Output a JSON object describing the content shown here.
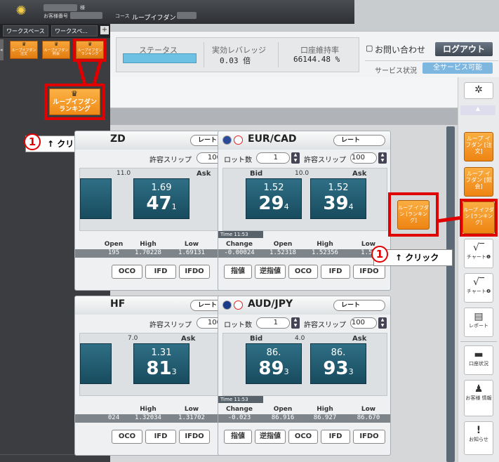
{
  "header": {
    "honorific": "様",
    "customer_number_label": "お客様番号",
    "course_label": "コース",
    "course_value": "ループイフダン"
  },
  "workspace": {
    "tabs": [
      "ワークスペース",
      "ワークスペ..."
    ],
    "plus": "+"
  },
  "left_minis": [
    {
      "label": "ループイフダン 注文"
    },
    {
      "label": "ループイフダン 照会"
    },
    {
      "label": "ループイフダン ランキング"
    }
  ],
  "big_button": {
    "label": "ループイフダン ランキング"
  },
  "callouts": [
    {
      "num": "1",
      "text": "↑ クリック"
    },
    {
      "num": "1",
      "text": "↑ クリック"
    }
  ],
  "status": {
    "status_label": "ステータス",
    "leverage_label": "実効レバレッジ",
    "leverage_value": "0.03 倍",
    "margin_label": "口座維持率",
    "margin_value": "66144.48 %"
  },
  "topright": {
    "inquiry": "お問い合わせ",
    "logout": "ログアウト",
    "service_label": "サービス状況",
    "service_value": "全サービス可能"
  },
  "rightnav": {
    "gear": "✲",
    "order": "ループ イフダン [注文]",
    "inquiry": "ループ イフダン [照会]",
    "ranking": "ループ イフダン [ランキング]",
    "chart1": "チャート❶",
    "chart2": "チャート❷",
    "report": "レポート",
    "account": "口座状況",
    "customer": "お客様 情報",
    "notice": "お知らせ"
  },
  "ranking_float": {
    "label": "ループ イフダン [ランキング]"
  },
  "panels": {
    "p1": {
      "name": "ZD",
      "spread": "11.0",
      "bid_sm": "",
      "bid_big": "",
      "ask_sm": "1.69",
      "ask_big": "47",
      "ask_x": "1",
      "change": "",
      "open": "195",
      "high": "1.70228",
      "low": "1.69131"
    },
    "p2": {
      "name": "EUR/CAD",
      "spread": "10.0",
      "bid_sm": "1.52",
      "bid_big": "29",
      "bid_x": "4",
      "ask_sm": "1.52",
      "ask_big": "39",
      "ask_x": "4",
      "time": "11:53",
      "change": "-0.00024",
      "open": "1.52318",
      "high": "1.52356",
      "low": "1.52"
    },
    "p3": {
      "name": "HF",
      "spread": "7.0",
      "ask_sm": "1.31",
      "ask_big": "81",
      "ask_x": "3",
      "open": "024",
      "high": "1.32034",
      "low": "1.31702"
    },
    "p4": {
      "name": "AUD/JPY",
      "spread": "4.0",
      "bid_sm": "86.",
      "bid_big": "89",
      "bid_x": "3",
      "ask_sm": "86.",
      "ask_big": "93",
      "ask_x": "3",
      "time": "11:53",
      "change": "-0.023",
      "open": "86.916",
      "high": "86.927",
      "low": "86.670"
    }
  },
  "common": {
    "rate": "レート",
    "lot": "ロット数",
    "lot_value": "1",
    "slip": "許容スリップ",
    "slip_value": "100",
    "bid": "Bid",
    "ask": "Ask",
    "time": "Time",
    "change": "Change",
    "open": "Open",
    "high": "High",
    "low": "Low",
    "btn_limit": "指値",
    "btn_stop": "逆指値",
    "btn_oco": "OCO",
    "btn_ifd": "IFD",
    "btn_ifdo": "IFDO"
  }
}
